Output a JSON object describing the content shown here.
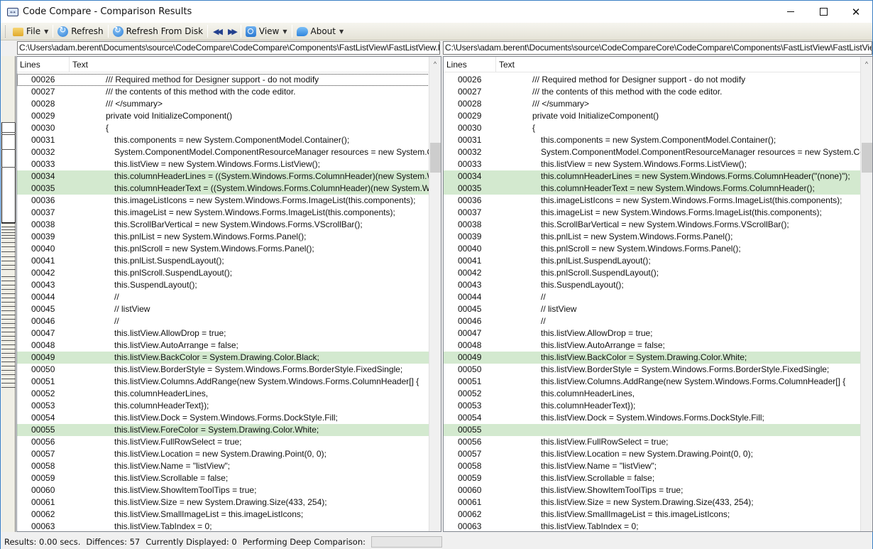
{
  "window": {
    "title": "Code Compare - Comparison Results",
    "controls": {
      "minimize": "",
      "maximize": "",
      "close": "✕"
    }
  },
  "toolbar": {
    "file_label": "File",
    "refresh_label": "Refresh",
    "refresh_disk_label": "Refresh From Disk",
    "prev_diff": "◀◀",
    "next_diff": "▶▶",
    "view_label": "View",
    "about_label": "About",
    "caret": "▼"
  },
  "left": {
    "path": "C:\\Users\\adam.berent\\Documents\\source\\CodeCompare\\CodeCompare\\Components\\FastListView\\FastListView.Designer.cs",
    "columns": {
      "lines": "Lines",
      "text": "Text"
    },
    "rows": [
      {
        "n": "00026",
        "t": "/// Required method for Designer support - do not modify",
        "diff": false,
        "indent": 0
      },
      {
        "n": "00027",
        "t": "/// the contents of this method with the code editor.",
        "diff": false,
        "indent": 0
      },
      {
        "n": "00028",
        "t": "/// </summary>",
        "diff": false,
        "indent": 0
      },
      {
        "n": "00029",
        "t": "private void InitializeComponent()",
        "diff": false,
        "indent": 0
      },
      {
        "n": "00030",
        "t": "{",
        "diff": false,
        "indent": 0
      },
      {
        "n": "00031",
        "t": "this.components = new System.ComponentModel.Container();",
        "diff": false,
        "indent": 1
      },
      {
        "n": "00032",
        "t": "System.ComponentModel.ComponentResourceManager resources = new System.ComponentModel.ComponentResourceManager(typeof(FastListView));",
        "diff": false,
        "indent": 1
      },
      {
        "n": "00033",
        "t": "this.listView = new System.Windows.Forms.ListView();",
        "diff": false,
        "indent": 1
      },
      {
        "n": "00034",
        "t": "this.columnHeaderLines = ((System.Windows.Forms.ColumnHeader)(new System.Windows.Forms.ColumnHeader()));",
        "diff": true,
        "indent": 1
      },
      {
        "n": "00035",
        "t": "this.columnHeaderText = ((System.Windows.Forms.ColumnHeader)(new System.Windows.Forms.ColumnHeader()));",
        "diff": true,
        "indent": 1
      },
      {
        "n": "00036",
        "t": "this.imageListIcons = new System.Windows.Forms.ImageList(this.components);",
        "diff": false,
        "indent": 1
      },
      {
        "n": "00037",
        "t": "this.imageList = new System.Windows.Forms.ImageList(this.components);",
        "diff": false,
        "indent": 1
      },
      {
        "n": "00038",
        "t": "this.ScrollBarVertical = new System.Windows.Forms.VScrollBar();",
        "diff": false,
        "indent": 1
      },
      {
        "n": "00039",
        "t": "this.pnlList = new System.Windows.Forms.Panel();",
        "diff": false,
        "indent": 1
      },
      {
        "n": "00040",
        "t": "this.pnlScroll = new System.Windows.Forms.Panel();",
        "diff": false,
        "indent": 1
      },
      {
        "n": "00041",
        "t": "this.pnlList.SuspendLayout();",
        "diff": false,
        "indent": 1
      },
      {
        "n": "00042",
        "t": "this.pnlScroll.SuspendLayout();",
        "diff": false,
        "indent": 1
      },
      {
        "n": "00043",
        "t": "this.SuspendLayout();",
        "diff": false,
        "indent": 1
      },
      {
        "n": "00044",
        "t": "//",
        "diff": false,
        "indent": 1
      },
      {
        "n": "00045",
        "t": "// listView",
        "diff": false,
        "indent": 1
      },
      {
        "n": "00046",
        "t": "//",
        "diff": false,
        "indent": 1
      },
      {
        "n": "00047",
        "t": "this.listView.AllowDrop = true;",
        "diff": false,
        "indent": 1
      },
      {
        "n": "00048",
        "t": "this.listView.AutoArrange = false;",
        "diff": false,
        "indent": 1
      },
      {
        "n": "00049",
        "t": "this.listView.BackColor = System.Drawing.Color.Black;",
        "diff": true,
        "indent": 1
      },
      {
        "n": "00050",
        "t": "this.listView.BorderStyle = System.Windows.Forms.BorderStyle.FixedSingle;",
        "diff": false,
        "indent": 1
      },
      {
        "n": "00051",
        "t": "this.listView.Columns.AddRange(new System.Windows.Forms.ColumnHeader[] {",
        "diff": false,
        "indent": 1
      },
      {
        "n": "00052",
        "t": "this.columnHeaderLines,",
        "diff": false,
        "indent": 1
      },
      {
        "n": "00053",
        "t": "this.columnHeaderText});",
        "diff": false,
        "indent": 1
      },
      {
        "n": "00054",
        "t": "this.listView.Dock = System.Windows.Forms.DockStyle.Fill;",
        "diff": false,
        "indent": 1
      },
      {
        "n": "00055",
        "t": "this.listView.ForeColor = System.Drawing.Color.White;",
        "diff": true,
        "indent": 1
      },
      {
        "n": "00056",
        "t": "this.listView.FullRowSelect = true;",
        "diff": false,
        "indent": 1
      },
      {
        "n": "00057",
        "t": "this.listView.Location = new System.Drawing.Point(0, 0);",
        "diff": false,
        "indent": 1
      },
      {
        "n": "00058",
        "t": "this.listView.Name = \"listView\";",
        "diff": false,
        "indent": 1
      },
      {
        "n": "00059",
        "t": "this.listView.Scrollable = false;",
        "diff": false,
        "indent": 1
      },
      {
        "n": "00060",
        "t": "this.listView.ShowItemToolTips = true;",
        "diff": false,
        "indent": 1
      },
      {
        "n": "00061",
        "t": "this.listView.Size = new System.Drawing.Size(433, 254);",
        "diff": false,
        "indent": 1
      },
      {
        "n": "00062",
        "t": "this.listView.SmallImageList = this.imageListIcons;",
        "diff": false,
        "indent": 1
      },
      {
        "n": "00063",
        "t": "this.listView.TabIndex = 0;",
        "diff": false,
        "indent": 1
      }
    ]
  },
  "right": {
    "path": "C:\\Users\\adam.berent\\Documents\\source\\CodeCompareCore\\CodeCompare\\Components\\FastListView\\FastListView.Designer.cs",
    "columns": {
      "lines": "Lines",
      "text": "Text"
    },
    "rows": [
      {
        "n": "00026",
        "t": "/// Required method for Designer support - do not modify",
        "diff": false,
        "indent": 0
      },
      {
        "n": "00027",
        "t": "/// the contents of this method with the code editor.",
        "diff": false,
        "indent": 0
      },
      {
        "n": "00028",
        "t": "/// </summary>",
        "diff": false,
        "indent": 0
      },
      {
        "n": "00029",
        "t": "private void InitializeComponent()",
        "diff": false,
        "indent": 0
      },
      {
        "n": "00030",
        "t": "{",
        "diff": false,
        "indent": 0
      },
      {
        "n": "00031",
        "t": "this.components = new System.ComponentModel.Container();",
        "diff": false,
        "indent": 1
      },
      {
        "n": "00032",
        "t": "System.ComponentModel.ComponentResourceManager resources = new System.ComponentModel.ComponentResourceManager(typeof(FastListView));",
        "diff": false,
        "indent": 1
      },
      {
        "n": "00033",
        "t": "this.listView = new System.Windows.Forms.ListView();",
        "diff": false,
        "indent": 1
      },
      {
        "n": "00034",
        "t": "this.columnHeaderLines = new System.Windows.Forms.ColumnHeader(\"(none)\");",
        "diff": true,
        "indent": 1
      },
      {
        "n": "00035",
        "t": "this.columnHeaderText = new System.Windows.Forms.ColumnHeader();",
        "diff": true,
        "indent": 1
      },
      {
        "n": "00036",
        "t": "this.imageListIcons = new System.Windows.Forms.ImageList(this.components);",
        "diff": false,
        "indent": 1
      },
      {
        "n": "00037",
        "t": "this.imageList = new System.Windows.Forms.ImageList(this.components);",
        "diff": false,
        "indent": 1
      },
      {
        "n": "00038",
        "t": "this.ScrollBarVertical = new System.Windows.Forms.VScrollBar();",
        "diff": false,
        "indent": 1
      },
      {
        "n": "00039",
        "t": "this.pnlList = new System.Windows.Forms.Panel();",
        "diff": false,
        "indent": 1
      },
      {
        "n": "00040",
        "t": "this.pnlScroll = new System.Windows.Forms.Panel();",
        "diff": false,
        "indent": 1
      },
      {
        "n": "00041",
        "t": "this.pnlList.SuspendLayout();",
        "diff": false,
        "indent": 1
      },
      {
        "n": "00042",
        "t": "this.pnlScroll.SuspendLayout();",
        "diff": false,
        "indent": 1
      },
      {
        "n": "00043",
        "t": "this.SuspendLayout();",
        "diff": false,
        "indent": 1
      },
      {
        "n": "00044",
        "t": "//",
        "diff": false,
        "indent": 1
      },
      {
        "n": "00045",
        "t": "// listView",
        "diff": false,
        "indent": 1
      },
      {
        "n": "00046",
        "t": "//",
        "diff": false,
        "indent": 1
      },
      {
        "n": "00047",
        "t": "this.listView.AllowDrop = true;",
        "diff": false,
        "indent": 1
      },
      {
        "n": "00048",
        "t": "this.listView.AutoArrange = false;",
        "diff": false,
        "indent": 1
      },
      {
        "n": "00049",
        "t": "this.listView.BackColor = System.Drawing.Color.White;",
        "diff": true,
        "indent": 1
      },
      {
        "n": "00050",
        "t": "this.listView.BorderStyle = System.Windows.Forms.BorderStyle.FixedSingle;",
        "diff": false,
        "indent": 1
      },
      {
        "n": "00051",
        "t": "this.listView.Columns.AddRange(new System.Windows.Forms.ColumnHeader[] {",
        "diff": false,
        "indent": 1
      },
      {
        "n": "00052",
        "t": "this.columnHeaderLines,",
        "diff": false,
        "indent": 1
      },
      {
        "n": "00053",
        "t": "this.columnHeaderText});",
        "diff": false,
        "indent": 1
      },
      {
        "n": "00054",
        "t": "this.listView.Dock = System.Windows.Forms.DockStyle.Fill;",
        "diff": false,
        "indent": 1
      },
      {
        "n": "00055",
        "t": "",
        "diff": true,
        "indent": 1
      },
      {
        "n": "00056",
        "t": "this.listView.FullRowSelect = true;",
        "diff": false,
        "indent": 1
      },
      {
        "n": "00057",
        "t": "this.listView.Location = new System.Drawing.Point(0, 0);",
        "diff": false,
        "indent": 1
      },
      {
        "n": "00058",
        "t": "this.listView.Name = \"listView\";",
        "diff": false,
        "indent": 1
      },
      {
        "n": "00059",
        "t": "this.listView.Scrollable = false;",
        "diff": false,
        "indent": 1
      },
      {
        "n": "00060",
        "t": "this.listView.ShowItemToolTips = true;",
        "diff": false,
        "indent": 1
      },
      {
        "n": "00061",
        "t": "this.listView.Size = new System.Drawing.Size(433, 254);",
        "diff": false,
        "indent": 1
      },
      {
        "n": "00062",
        "t": "this.listView.SmallImageList = this.imageListIcons;",
        "diff": false,
        "indent": 1
      },
      {
        "n": "00063",
        "t": "this.listView.TabIndex = 0;",
        "diff": false,
        "indent": 1
      }
    ]
  },
  "status": {
    "results": "Results: 0.00 secs.",
    "differences": "Diffences: 57",
    "displayed": "Currently Displayed: 0",
    "deep_comparison": "Performing Deep Comparison:",
    "progress_fraction": 0
  },
  "colors": {
    "diff_row": "#d3e9cf",
    "window_border": "#3b7fc4"
  }
}
